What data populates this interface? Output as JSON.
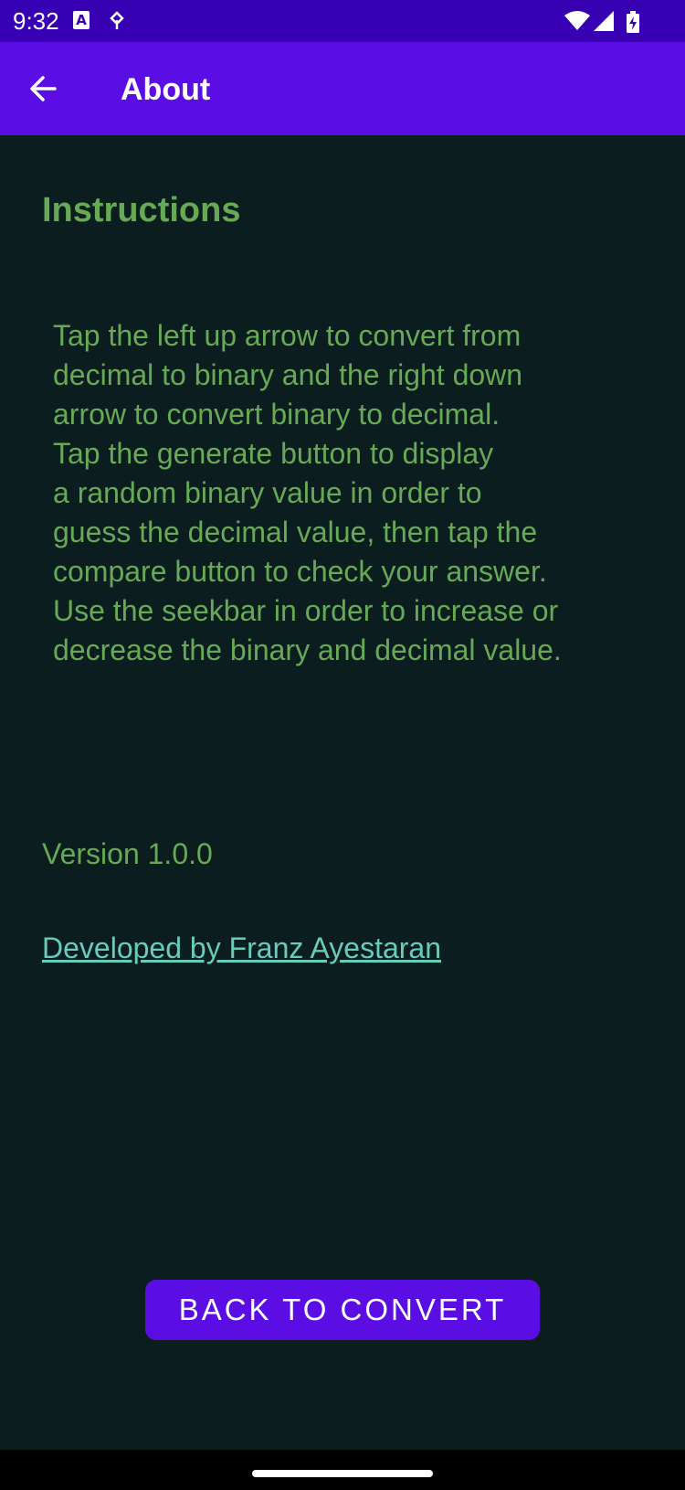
{
  "status_bar": {
    "time": "9:32",
    "app_icon_letter": "A",
    "icons": [
      "a-app-icon",
      "vpn-key-icon",
      "wifi-icon",
      "cell-signal-icon",
      "battery-charging-icon"
    ]
  },
  "app_bar": {
    "title": "About",
    "back_icon": "arrow-left-icon",
    "color": "#5b0ee3"
  },
  "content": {
    "heading": "Instructions",
    "instructions": "Tap the left up arrow to convert from\ndecimal to binary and the right down\narrow to convert binary to decimal.\nTap the generate button to display\na random binary value in order to\nguess the decimal value, then tap the\ncompare button to check your answer.\nUse the seekbar in order to increase or\ndecrease the binary and decimal value.",
    "version": "Version 1.0.0",
    "developer_link": "Developed by Franz Ayestaran"
  },
  "actions": {
    "back_to_convert_label": "BACK TO CONVERT"
  },
  "colors": {
    "background": "#0c1d1f",
    "text_green": "#66aa55",
    "link_teal": "#66ccbb",
    "status_bar": "#3700b3",
    "accent": "#5b0ee3"
  }
}
